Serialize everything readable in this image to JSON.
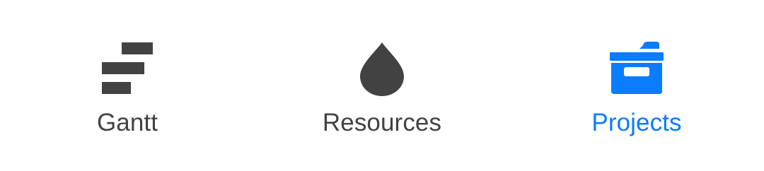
{
  "tab_bar": {
    "tabs": [
      {
        "label": "Gantt",
        "icon": "gantt-icon",
        "selected": false
      },
      {
        "label": "Resources",
        "icon": "drop-icon",
        "selected": false
      },
      {
        "label": "Projects",
        "icon": "folder-icon",
        "selected": true
      }
    ]
  },
  "colors": {
    "inactive": "#424242",
    "active": "#0a7cff",
    "background": "#ffffff"
  }
}
